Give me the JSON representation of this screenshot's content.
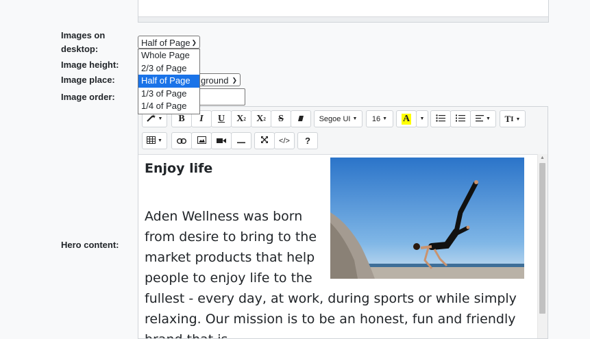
{
  "form": {
    "images_on_desktop_label": "Images on desktop:",
    "image_height_label": "Image height:",
    "image_place_label": "Image place:",
    "image_order_label": "Image order:",
    "hero_content_label": "Hero content:",
    "images_on_desktop_value": "Half of Page",
    "image_place_value_visible": "ground",
    "dropdown_options": [
      "Whole Page",
      "2/3 of Page",
      "Half of Page",
      "1/3 of Page",
      "1/4 of Page"
    ],
    "dropdown_selected": "Half of Page"
  },
  "toolbar": {
    "row1": {
      "magic_label": "",
      "bold": "B",
      "italic": "I",
      "underline": "U",
      "superscript": "X",
      "subscript": "X",
      "strike": "S",
      "font_family": "Segoe UI",
      "font_size": "16",
      "color_letter": "A",
      "style_label": "T"
    },
    "row2": {
      "help": "?",
      "code": "</>"
    }
  },
  "content": {
    "heading": "Enjoy life",
    "paragraph": "Aden Wellness was born from desire to bring to the market products that help people to enjoy life to the fullest - every day, at work, during sports or while simply relaxing. Our mission is to be an honest, fun and friendly brand that is"
  },
  "colors": {
    "highlight_yellow": "#ffff00",
    "selected_option": "#1a73e8"
  }
}
